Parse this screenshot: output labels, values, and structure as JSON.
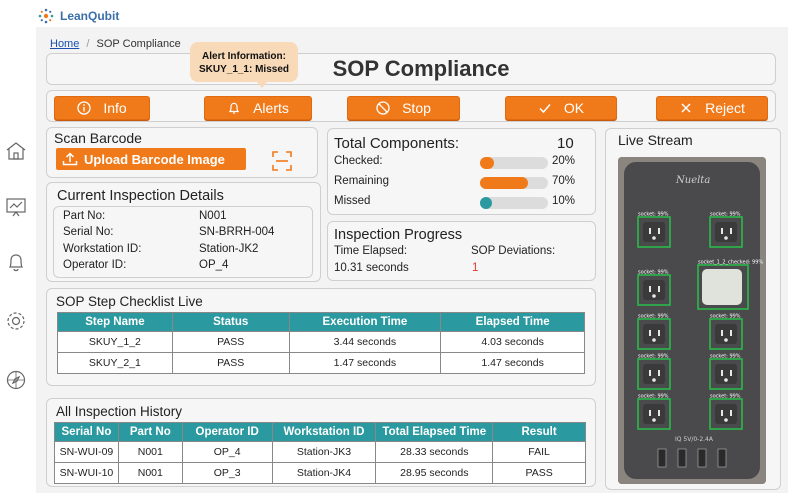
{
  "app": {
    "name": "LeanQubit"
  },
  "breadcrumb": {
    "home": "Home",
    "separator": "/",
    "current": "SOP Compliance"
  },
  "page_title": "SOP Compliance",
  "alert_tooltip": {
    "line1": "Alert Information:",
    "line2": "SKUY_1_1:  Missed"
  },
  "toolbar": {
    "info": "Info",
    "alerts": "Alerts",
    "stop": "Stop",
    "ok": "OK",
    "reject": "Reject"
  },
  "scan": {
    "title": "Scan Barcode",
    "upload_label": "Upload Barcode Image"
  },
  "components": {
    "title": "Total Components:",
    "total": "10",
    "rows": [
      {
        "label": "Checked:",
        "percent_text": "20%",
        "fraction": 0.2,
        "color": "#f07a1a"
      },
      {
        "label": "Remaining",
        "percent_text": "70%",
        "fraction": 0.7,
        "color": "#f07a1a"
      },
      {
        "label": "Missed",
        "percent_text": "10%",
        "fraction": 0.1,
        "color": "#2b9aa0"
      }
    ]
  },
  "inspection": {
    "title": "Current Inspection Details",
    "part_label": "Part No:",
    "part_value": "N001",
    "serial_label": "Serial No:",
    "serial_value": "SN-BRRH-004",
    "ws_label": "Workstation ID:",
    "ws_value": "Station-JK2",
    "op_label": "Operator ID:",
    "op_value": "OP_4"
  },
  "progress": {
    "title": "Inspection Progress",
    "time_label": "Time Elapsed:",
    "time_value": "10.31 seconds",
    "dev_label": "SOP Deviations:",
    "dev_value": "1"
  },
  "live_stream": {
    "title": "Live Stream",
    "brand": "Nuelta",
    "port_label": "IQ 5V/0-2.4A"
  },
  "checklist": {
    "title": "SOP Step Checklist Live",
    "headers": [
      "Step Name",
      "Status",
      "Execution Time",
      "Elapsed Time"
    ],
    "rows": [
      [
        "SKUY_1_2",
        "PASS",
        "3.44 seconds",
        "4.03 seconds"
      ],
      [
        "SKUY_2_1",
        "PASS",
        "1.47 seconds",
        "1.47 seconds"
      ]
    ]
  },
  "history": {
    "title": "All Inspection History",
    "headers": [
      "Serial No",
      "Part No",
      "Operator ID",
      "Workstation ID",
      "Total Elapsed Time",
      "Result"
    ],
    "rows": [
      [
        "SN-WUI-09",
        "N001",
        "OP_4",
        "Station-JK3",
        "28.33 seconds",
        "FAIL"
      ],
      [
        "SN-WUI-10",
        "N001",
        "OP_3",
        "Station-JK4",
        "28.95 seconds",
        "PASS"
      ]
    ]
  },
  "detections": [
    "socket: 99%",
    "socket: 99%",
    "socket: 99%",
    "socket_1_2_checked: 99%",
    "socket: 99%",
    "socket: 99%",
    "socket: 99%",
    "socket: 99%",
    "socket: 99%",
    "socket: 99%",
    "socket: 99%",
    "socket: 99%"
  ]
}
